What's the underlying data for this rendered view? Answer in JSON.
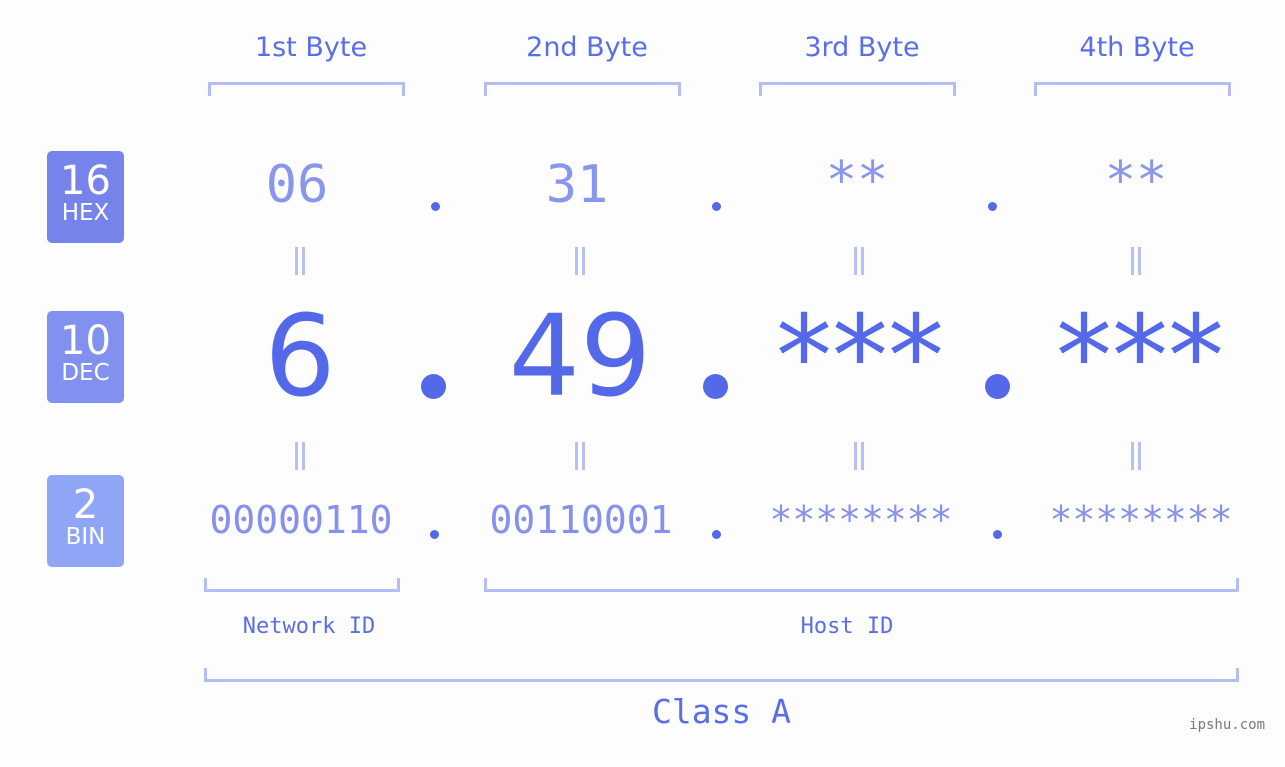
{
  "colors": {
    "accent": "#5468ea",
    "light_accent": "#b3bdf6",
    "hex_badge": "#7583ea",
    "dec_badge": "#8291f0",
    "bin_badge": "#8fa6f6"
  },
  "byte_headers": [
    "1st Byte",
    "2nd Byte",
    "3rd Byte",
    "4th Byte"
  ],
  "badges": [
    {
      "num": "16",
      "label": "HEX"
    },
    {
      "num": "10",
      "label": "DEC"
    },
    {
      "num": "2",
      "label": "BIN"
    }
  ],
  "hex": [
    "06",
    "31",
    "**",
    "**"
  ],
  "dec": [
    "6",
    "49",
    "***",
    "***"
  ],
  "bin": [
    "00000110",
    "00110001",
    "********",
    "********"
  ],
  "network_id_label": "Network ID",
  "host_id_label": "Host ID",
  "class_label": "Class A",
  "watermark": "ipshu.com"
}
